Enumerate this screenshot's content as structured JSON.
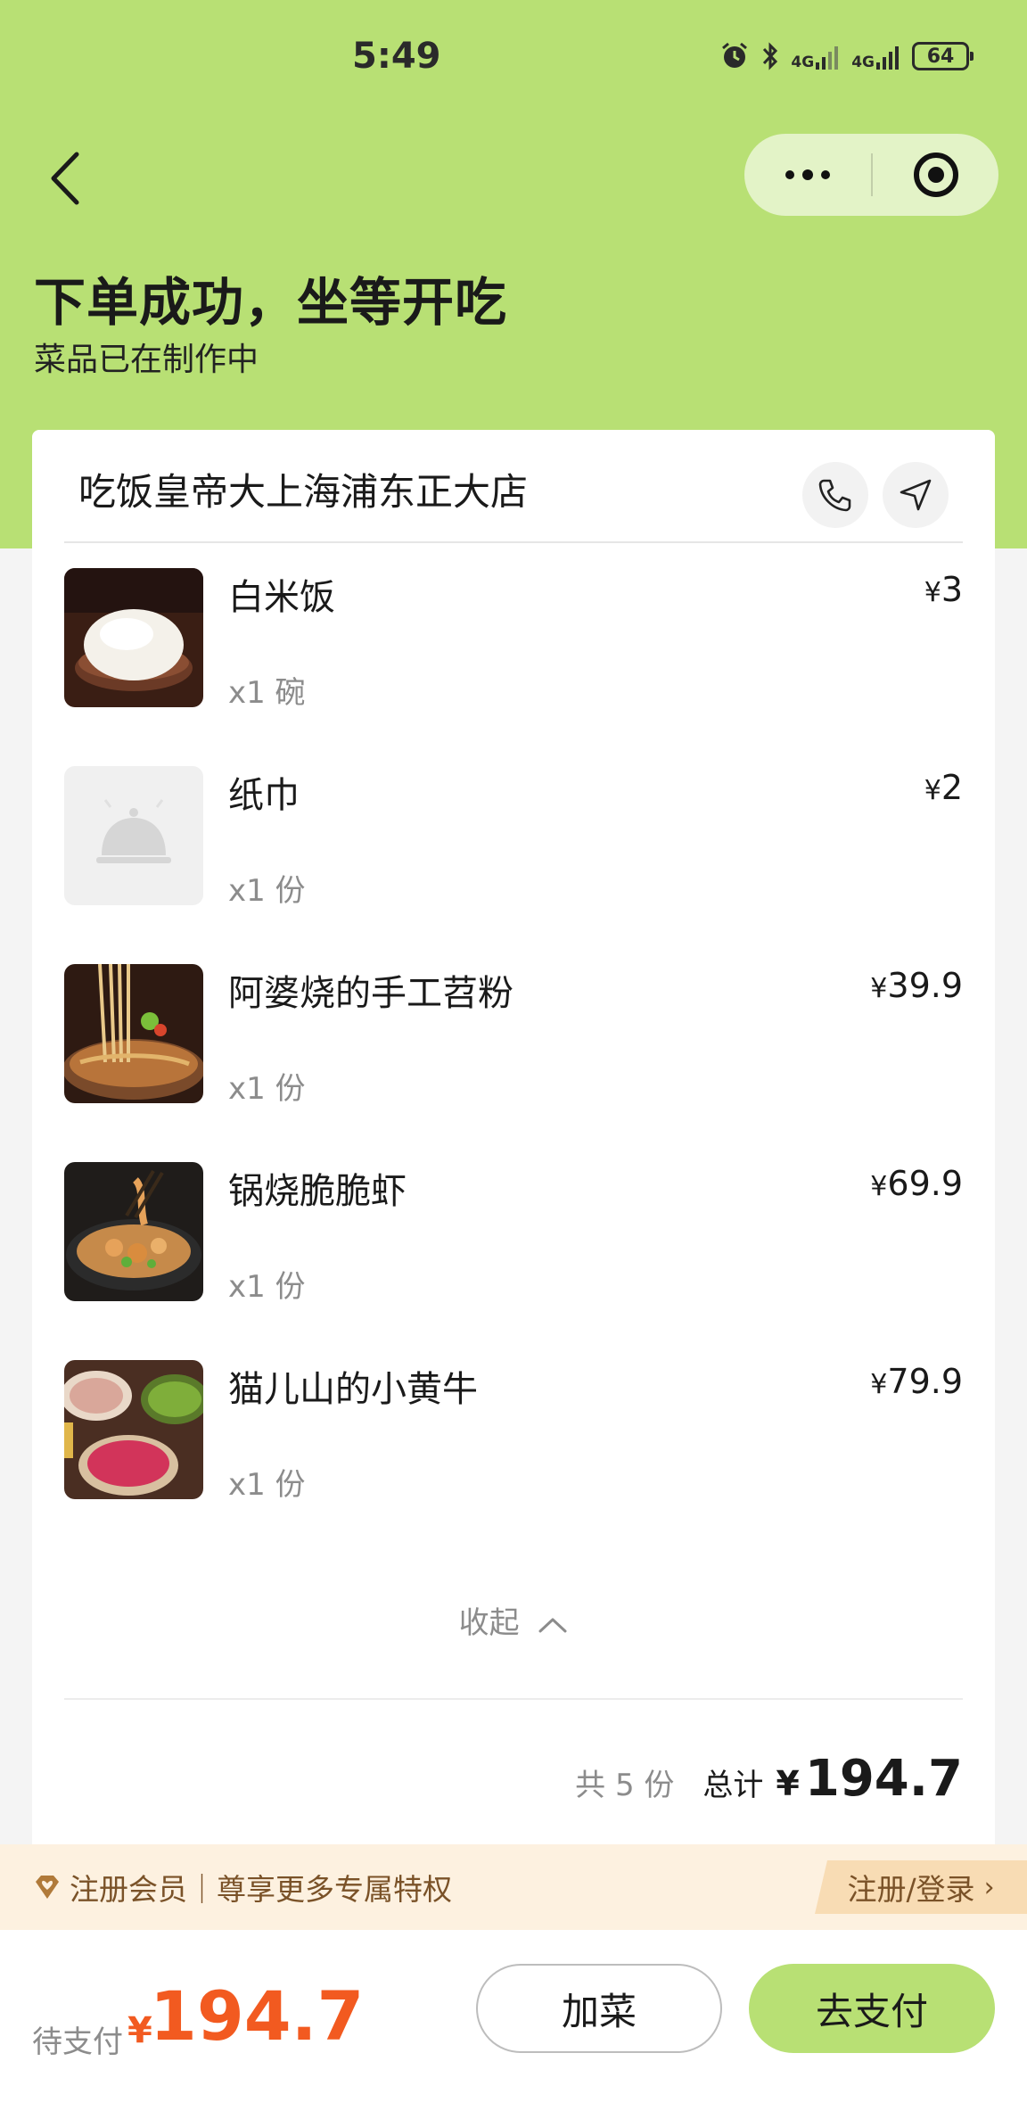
{
  "status_bar": {
    "time": "5:49",
    "network_1": "4G",
    "network_2": "4G",
    "battery": "64"
  },
  "nav": {
    "back_icon": "chevron-left-icon",
    "more_icon": "more-dots-icon",
    "close_icon": "target-close-icon"
  },
  "header": {
    "title": "下单成功，坐等开吃",
    "subtitle": "菜品已在制作中"
  },
  "store": {
    "name": "吃饭皇帝大上海浦东正大店",
    "phone_icon": "phone-icon",
    "navigate_icon": "navigation-arrow-icon"
  },
  "items": [
    {
      "name": "白米饭",
      "qty": "x1 碗",
      "price_symbol": "¥",
      "price": "3",
      "image": "rice-bowl-photo"
    },
    {
      "name": "纸巾",
      "qty": "x1 份",
      "price_symbol": "¥",
      "price": "2",
      "image": "placeholder-cloche-icon"
    },
    {
      "name": "阿婆烧的手工苕粉",
      "qty": "x1 份",
      "price_symbol": "¥",
      "price": "39.9",
      "image": "noodles-photo"
    },
    {
      "name": "锅烧脆脆虾",
      "qty": "x1 份",
      "price_symbol": "¥",
      "price": "69.9",
      "image": "shrimp-wok-photo"
    },
    {
      "name": "猫儿山的小黄牛",
      "qty": "x1 份",
      "price_symbol": "¥",
      "price": "79.9",
      "image": "beef-plates-photo"
    }
  ],
  "collapse_label": "收起",
  "summary": {
    "count": "共 5 份",
    "label": "总计",
    "currency": "¥",
    "total": "194.7"
  },
  "member": {
    "text": "注册会员｜尊享更多专属特权",
    "button": "注册/登录"
  },
  "bottom": {
    "pay_label": "待支付",
    "currency": "¥",
    "amount": "194.7",
    "add_button": "加菜",
    "pay_button": "去支付"
  },
  "colors": {
    "header_green": "#b8e074",
    "accent_orange": "#f25a20",
    "member_brown": "#7a5228"
  }
}
